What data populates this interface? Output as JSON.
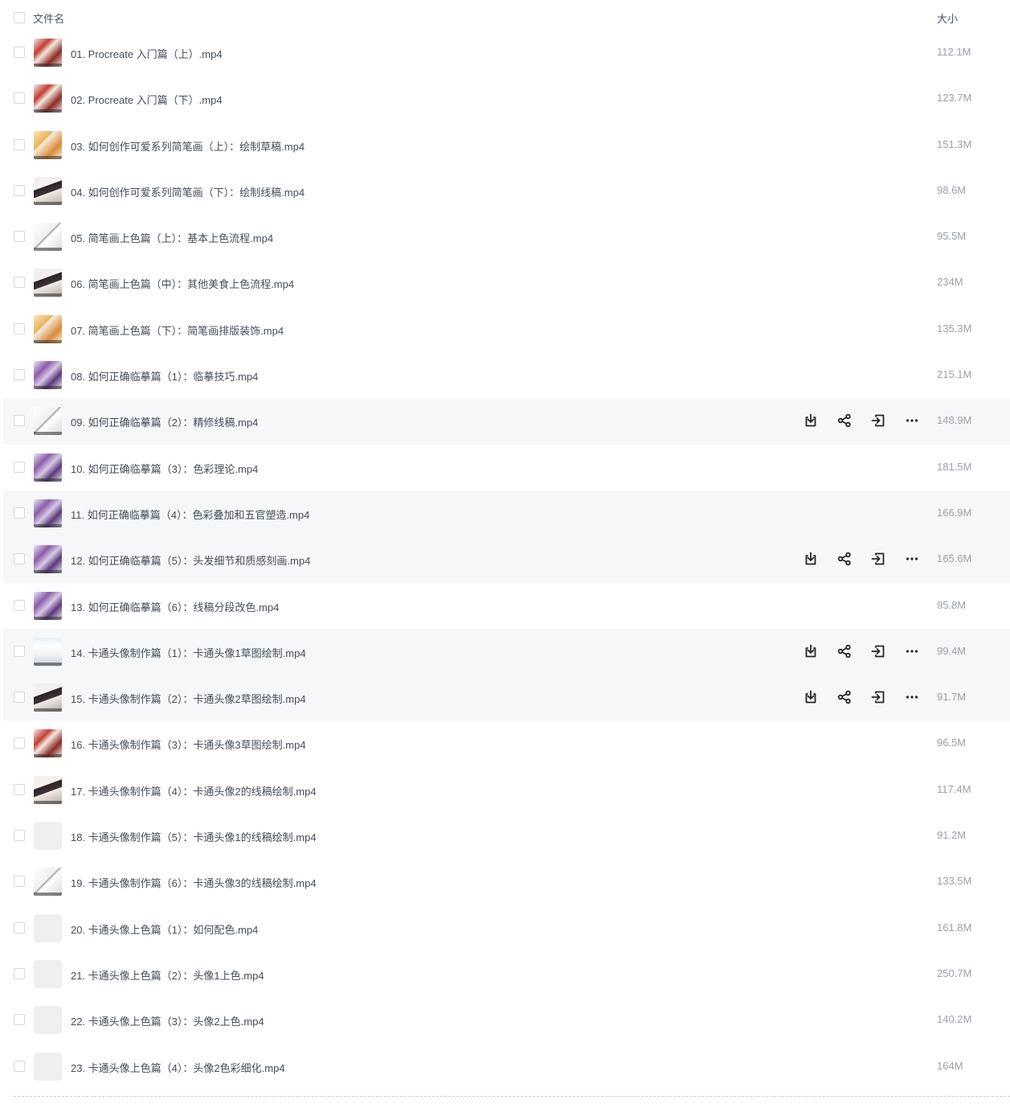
{
  "header": {
    "name_label": "文件名",
    "size_label": "大小"
  },
  "rows": [
    {
      "name": "01. Procreate 入门篇（上）.mp4",
      "size": "112.1M",
      "thumb": "red",
      "hover": false
    },
    {
      "name": "02. Procreate 入门篇（下）.mp4",
      "size": "123.7M",
      "thumb": "red",
      "hover": false
    },
    {
      "name": "03. 如何创作可爱系列简笔画（上）：绘制草稿.mp4",
      "size": "151.3M",
      "thumb": "warm",
      "hover": false
    },
    {
      "name": "04. 如何创作可爱系列简笔画（下）：绘制线稿.mp4",
      "size": "98.6M",
      "thumb": "dark",
      "hover": false
    },
    {
      "name": "05. 简笔画上色篇（上）：基本上色流程.mp4",
      "size": "95.5M",
      "thumb": "sketch",
      "hover": false
    },
    {
      "name": "06. 简笔画上色篇（中）：其他美食上色流程.mp4",
      "size": "234M",
      "thumb": "dark",
      "hover": false
    },
    {
      "name": "07. 简笔画上色篇（下）：简笔画排版装饰.mp4",
      "size": "135.3M",
      "thumb": "warm",
      "hover": false
    },
    {
      "name": "08. 如何正确临摹篇（1）：临摹技巧.mp4",
      "size": "215.1M",
      "thumb": "purple",
      "hover": false
    },
    {
      "name": "09. 如何正确临摹篇（2）：精修线稿.mp4",
      "size": "148.9M",
      "thumb": "sketch",
      "hover": true
    },
    {
      "name": "10. 如何正确临摹篇（3）：色彩理论.mp4",
      "size": "181.5M",
      "thumb": "purple",
      "hover": false
    },
    {
      "name": "11. 如何正确临摹篇（4）：色彩叠加和五官塑造.mp4",
      "size": "166.9M",
      "thumb": "purple",
      "hover": true
    },
    {
      "name": "12. 如何正确临摹篇（5）：头发细节和质感刻画.mp4",
      "size": "165.6M",
      "thumb": "purple",
      "hover": true
    },
    {
      "name": "13. 如何正确临摹篇（6）：线稿分段改色.mp4",
      "size": "95.8M",
      "thumb": "purple",
      "hover": false
    },
    {
      "name": "14. 卡通头像制作篇（1）：卡通头像1草图绘制.mp4",
      "size": "99.4M",
      "thumb": "blue",
      "hover": true
    },
    {
      "name": "15. 卡通头像制作篇（2）：卡通头像2草图绘制.mp4",
      "size": "91.7M",
      "thumb": "dark",
      "hover": true
    },
    {
      "name": "16. 卡通头像制作篇（3）：卡通头像3草图绘制.mp4",
      "size": "96.5M",
      "thumb": "red",
      "hover": false
    },
    {
      "name": "17. 卡通头像制作篇（4）：卡通头像2的线稿绘制.mp4",
      "size": "117.4M",
      "thumb": "dark",
      "hover": false
    },
    {
      "name": "18. 卡通头像制作篇（5）：卡通头像1的线稿绘制.mp4",
      "size": "91.2M",
      "thumb": "none",
      "hover": false
    },
    {
      "name": "19. 卡通头像制作篇（6）：卡通头像3的线稿绘制.mp4",
      "size": "133.5M",
      "thumb": "sketch",
      "hover": false
    },
    {
      "name": "20. 卡通头像上色篇（1）：如何配色.mp4",
      "size": "161.8M",
      "thumb": "none",
      "hover": false
    },
    {
      "name": "21. 卡通头像上色篇（2）：头像1上色.mp4",
      "size": "250.7M",
      "thumb": "none",
      "hover": false
    },
    {
      "name": "22. 卡通头像上色篇（3）：头像2上色.mp4",
      "size": "140.2M",
      "thumb": "none",
      "hover": false
    },
    {
      "name": "23. 卡通头像上色篇（4）：头像2色彩细化.mp4",
      "size": "164M",
      "thumb": "none",
      "hover": false
    }
  ],
  "actions_visible_rows": [
    8,
    11,
    13,
    14
  ],
  "actions": [
    {
      "icon": "download-icon"
    },
    {
      "icon": "share-icon"
    },
    {
      "icon": "move-icon"
    },
    {
      "icon": "more-icon"
    }
  ]
}
